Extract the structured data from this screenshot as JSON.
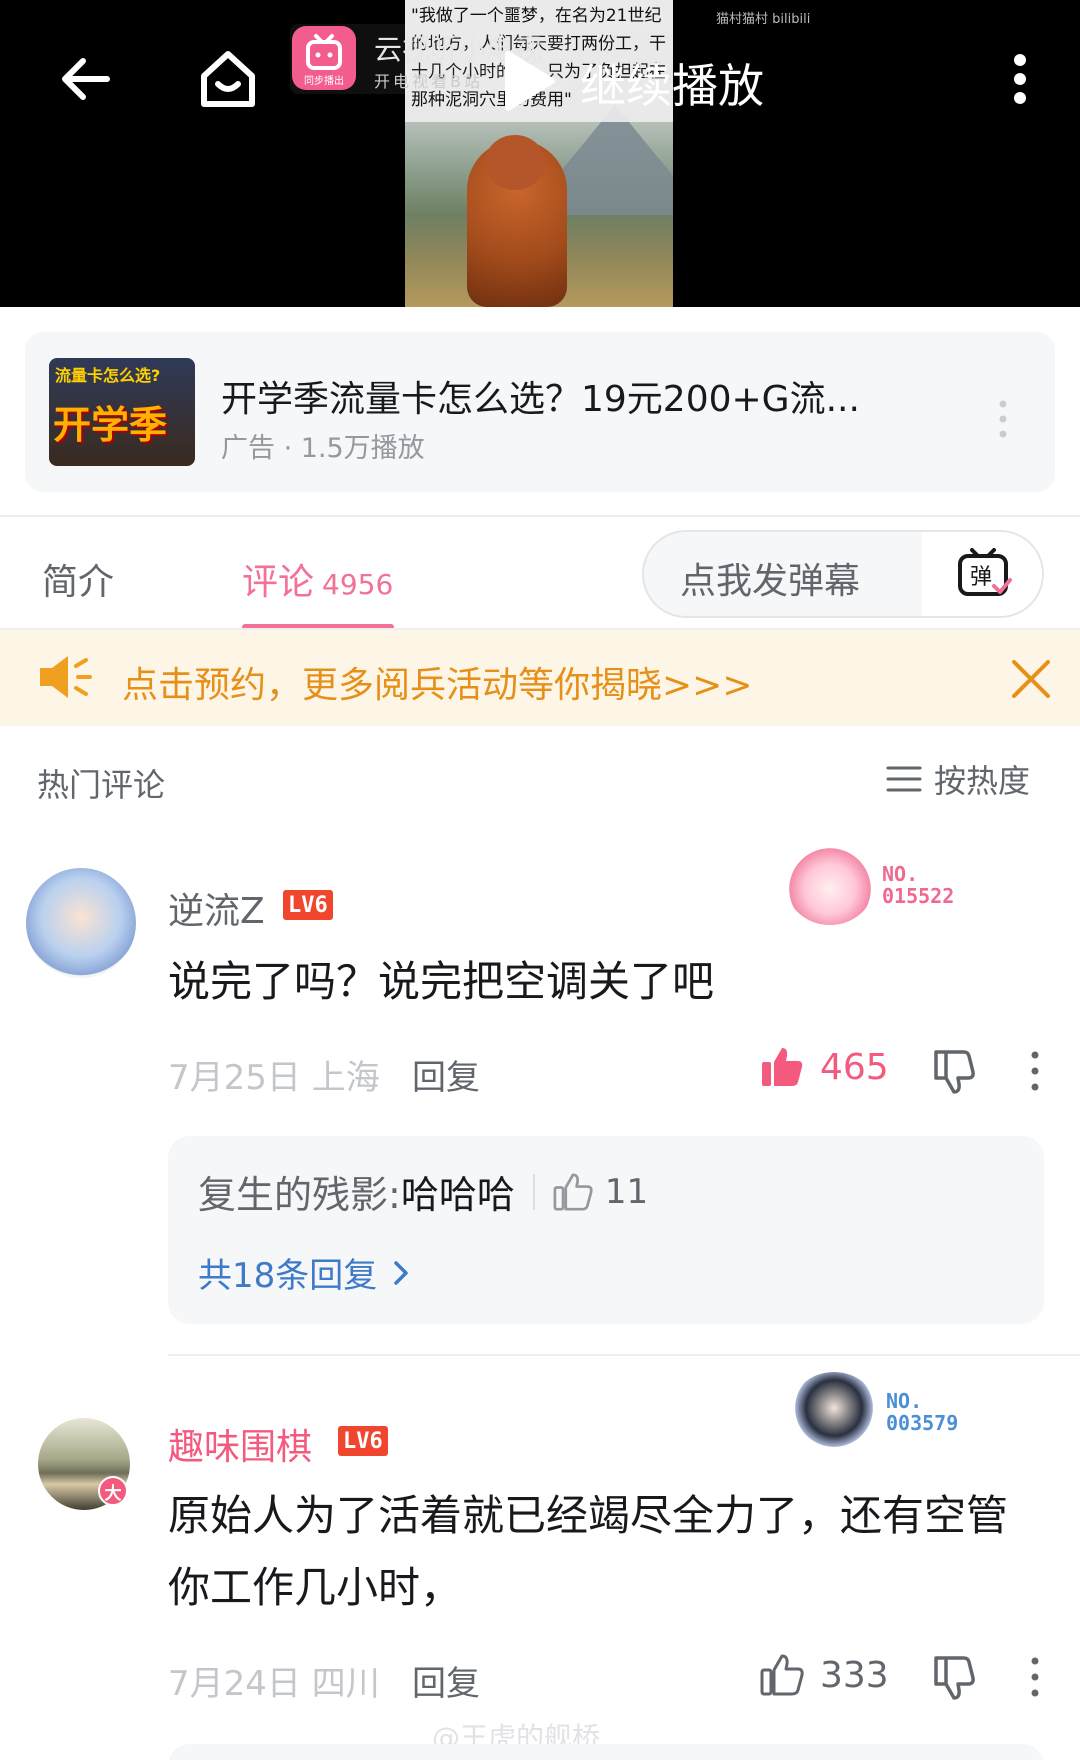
{
  "video": {
    "thumbnail_caption": "\"我做了一个噩梦，在名为21世纪的地方，人们每天要打两份工，干十几个小时的活，只为了负担起在那种泥洞穴里的费用\"",
    "site_watermark": "猫村猫村 bilibili",
    "cast_title": "云视听小电视",
    "cast_subtitle": "开电视看B站",
    "cast_badge": "同步播出",
    "continue_label": "继续播放",
    "icons": [
      "back-arrow-icon",
      "home-icon",
      "play-icon",
      "more-vertical-icon"
    ]
  },
  "ad": {
    "thumb_top": "流量卡怎么选?",
    "thumb_big": "开学季",
    "title": "开学季流量卡怎么选？19元200+G流...",
    "meta": "广告 · 1.5万播放"
  },
  "tabs": {
    "intro": "简介",
    "comments": "评论",
    "comments_count": "4956",
    "danmaku_placeholder": "点我发弹幕",
    "danmaku_icon_text": "弹"
  },
  "notice": {
    "text": "点击预约，更多阅兵活动等你揭晓>>>"
  },
  "section": {
    "title": "热门评论",
    "sort_label": "按热度"
  },
  "comments": [
    {
      "username": "逆流Z",
      "level": "LV6",
      "fan_no_label": "NO.",
      "fan_no": "015522",
      "text": "说完了吗？说完把空调关了吧",
      "date_location": "7月25日 上海",
      "reply_label": "回复",
      "likes": "465",
      "liked": true,
      "sub_reply": {
        "author": "复生的残影:",
        "text": "哈哈哈",
        "likes": "11",
        "all_replies_label": "共18条回复"
      }
    },
    {
      "username": "趣味围棋",
      "level": "LV6",
      "avatar_badge": "大",
      "fan_no_label": "NO.",
      "fan_no": "003579",
      "text": "原始人为了活着就已经竭尽全力了，还有空管你工作几小时，",
      "date_location": "7月24日 四川",
      "reply_label": "回复",
      "likes": "333",
      "liked": false
    }
  ],
  "watermark": "@王虎的舰桥",
  "colors": {
    "accent_pink": "#f27196",
    "notice_orange": "#e6901a",
    "link_blue": "#3d7ac7",
    "level_red": "#f0462e"
  }
}
